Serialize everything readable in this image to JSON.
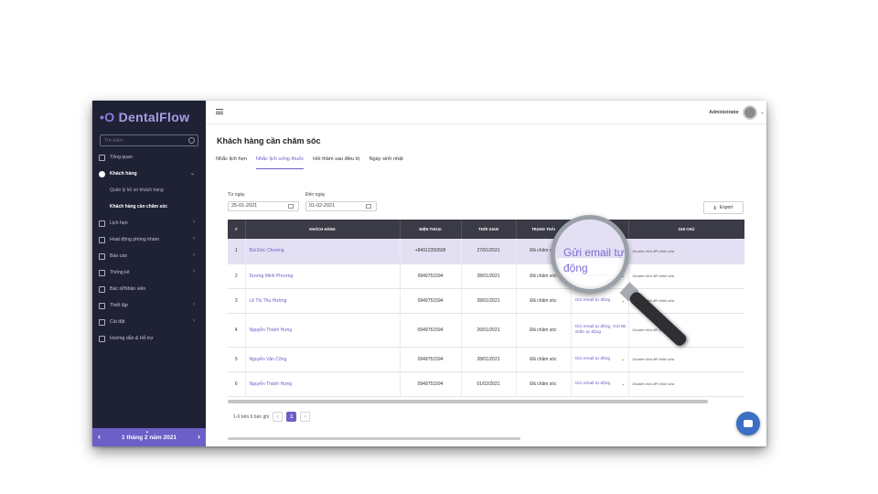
{
  "brand": {
    "name": "DentalFlow",
    "accent": "#6c5fc7",
    "sidebar_bg": "#1f2235"
  },
  "sidebar": {
    "search_placeholder": "Tìm kiếm",
    "items": [
      {
        "label": "Tổng quan",
        "icon": "dashboard-icon"
      },
      {
        "label": "Khách hàng",
        "icon": "user-icon"
      },
      {
        "label": "Lịch hẹn",
        "icon": "calendar-icon"
      },
      {
        "label": "Hoạt động phòng khám",
        "icon": "clinic-icon"
      },
      {
        "label": "Báo cáo",
        "icon": "report-icon"
      },
      {
        "label": "Thống kê",
        "icon": "stats-icon"
      },
      {
        "label": "Bác sĩ/Nhân viên",
        "icon": "staff-icon"
      },
      {
        "label": "Thiết lập",
        "icon": "setup-icon"
      },
      {
        "label": "Cài đặt",
        "icon": "gear-icon"
      },
      {
        "label": "Hướng dẫn & Hỗ trợ",
        "icon": "help-icon"
      }
    ],
    "subitems": [
      "Quản lý hồ sơ khách hàng",
      "Khách hàng cần chăm sóc"
    ],
    "date_label": "1 tháng 2 năm 2021"
  },
  "topbar": {
    "user": "Administrator"
  },
  "page": {
    "title": "Khách hàng cần chăm sóc"
  },
  "tabs": [
    "Nhắc lịch hẹn",
    "Nhắc lịch uống thuốc",
    "Hỏi thăm sau điều trị",
    "Ngày sinh nhật"
  ],
  "filters": {
    "from_label": "Từ ngày",
    "from_value": "25-01-2021",
    "to_label": "Đến ngày",
    "to_value": "01-02-2021",
    "export_label": "Export"
  },
  "table": {
    "headers": [
      "#",
      "KHÁCH HÀNG",
      "ĐIỆN THOẠI",
      "THỜI GIAN",
      "TRẠNG THÁI",
      "",
      "GHI CHÚ"
    ],
    "rows": [
      {
        "n": "1",
        "name": "Bùi Đức Chương",
        "phone": "+84912350508",
        "time": "27/01/2021",
        "status": "Đã chăm sóc",
        "action": "Gửi email tự động",
        "note": "Double click để chỉnh sửa"
      },
      {
        "n": "2",
        "name": "Dương Minh Phương",
        "phone": "0949751594",
        "time": "28/01/2021",
        "status": "Đã chăm sóc",
        "action": "Gửi email tự động",
        "note": "Double click để chỉnh sửa"
      },
      {
        "n": "3",
        "name": "Lê Thị Thu Hường",
        "phone": "0949751594",
        "time": "28/01/2021",
        "status": "Đã chăm sóc",
        "action": "Gửi email tự động",
        "note": "Double click để chỉnh sửa"
      },
      {
        "n": "4",
        "name": "Nguyễn Thành Hưng",
        "phone": "0949751594",
        "time": "26/01/2021",
        "status": "Đã chăm sóc",
        "action": "Gửi email tự động, Gửi tin nhắn tự động",
        "note": "Double click để chỉnh sửa"
      },
      {
        "n": "5",
        "name": "Nguyễn Văn Công",
        "phone": "0949751594",
        "time": "28/01/2021",
        "status": "Đã chăm sóc",
        "action": "Gửi email tự động",
        "note": "Double click để chỉnh sửa"
      },
      {
        "n": "6",
        "name": "Nguyễn Thành Hưng",
        "phone": "0949751594",
        "time": "01/02/2021",
        "status": "Đã chăm sóc",
        "action": "Gửi email tự động",
        "note": "Double click để chỉnh sửa"
      }
    ]
  },
  "pagination": {
    "summary": "1-6 trên 6 bản ghi",
    "current": "1",
    "prev": "<",
    "next": ">"
  },
  "magnifier": {
    "text": "Gửi email tự động"
  }
}
